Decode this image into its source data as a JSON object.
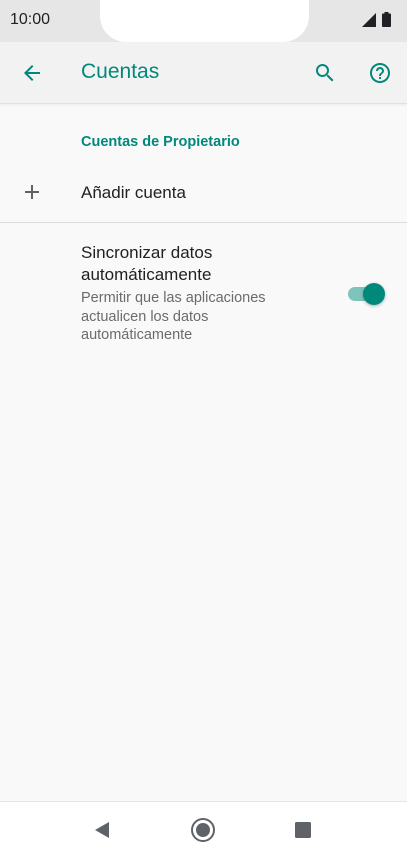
{
  "status_bar": {
    "time": "10:00",
    "icons": [
      "signal-icon",
      "battery-icon"
    ]
  },
  "app_bar": {
    "title": "Cuentas",
    "icons": [
      "back-arrow-icon",
      "search-icon",
      "help-icon"
    ]
  },
  "section": {
    "header": "Cuentas de Propietario"
  },
  "add_account": {
    "label": "Añadir cuenta",
    "icon": "plus-icon"
  },
  "auto_sync": {
    "title": "Sincronizar datos automáticamente",
    "summary": "Permitir que las aplicaciones actualicen los datos automáticamente",
    "enabled": true
  },
  "nav_bar": {
    "icons": [
      "nav-back-icon",
      "nav-home-icon",
      "nav-recents-icon"
    ]
  },
  "colors": {
    "accent": "#00897b",
    "accent_light": "#7fc4bc",
    "background": "#f9f9f9",
    "app_bar": "#f2f2f2",
    "status_bar": "#e6e6e6"
  }
}
